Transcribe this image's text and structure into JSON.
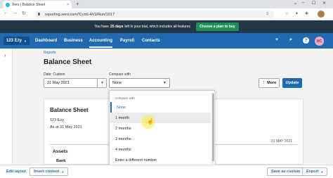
{
  "browser": {
    "tab_title": "Xero | Balance Sheet",
    "tab_close": "×",
    "new_tab": "+",
    "url": "reporting.xero.com/!CymL4/v1/Run/1017",
    "window_controls": [
      "⌄",
      "–",
      "☐",
      "✕"
    ]
  },
  "trial_banner": {
    "prefix": "You have",
    "days": "25 days",
    "suffix": "left in your trial, which includes all features",
    "button": "Choose a plan to buy"
  },
  "nav": {
    "org": "123 Ezy",
    "items": [
      "Dashboard",
      "Business",
      "Accounting",
      "Payroll",
      "Contacts"
    ],
    "active": "Accounting",
    "help": "?",
    "avatar": "HC"
  },
  "breadcrumb": "Reports",
  "page_title": "Balance Sheet",
  "controls": {
    "date_label": "Date: Custom",
    "date_value": "31 May 2021",
    "compare_label": "Compare with",
    "compare_value": "None",
    "more_button": "More",
    "update_button": "Update"
  },
  "report": {
    "title": "Balance Sheet",
    "org": "123 Ezy",
    "as_at": "As at 31 May 2021",
    "column_date": "31 MAY 2021",
    "section": "Assets",
    "subsection": "Bank"
  },
  "dropdown": {
    "header": "Compare with",
    "options": [
      "None",
      "1 month",
      "2 months",
      "3 months",
      "4 months",
      "Enter a different number"
    ],
    "selected": "None",
    "hovered": "1 month"
  },
  "footer": {
    "edit_layout": "Edit layout",
    "insert_content": "Insert content",
    "save_custom": "Save as custom",
    "export": "Export"
  },
  "colors": {
    "brand_blue": "#1f6ab0",
    "banner_dark": "#243746",
    "buy_green": "#1d8f5a"
  }
}
